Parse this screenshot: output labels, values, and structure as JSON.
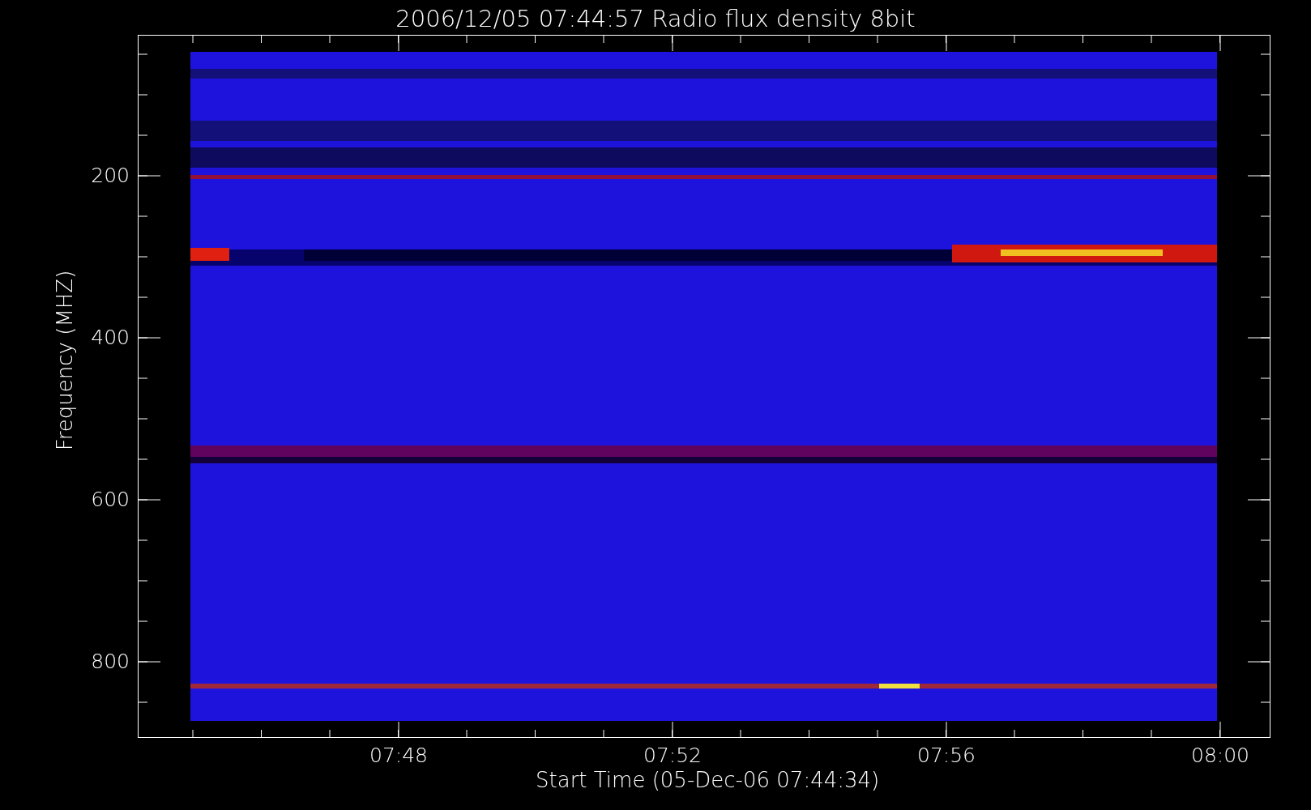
{
  "title": "2006/12/05 07:44:57 Radio flux density 8bit",
  "y_axis": {
    "label": "Frequency (MHZ)",
    "ticks": [
      "200",
      "400",
      "600",
      "800"
    ]
  },
  "x_axis": {
    "label": "Start Time (05-Dec-06 07:44:34)",
    "ticks": [
      "07:48",
      "07:52",
      "07:56",
      "08:00"
    ]
  }
}
